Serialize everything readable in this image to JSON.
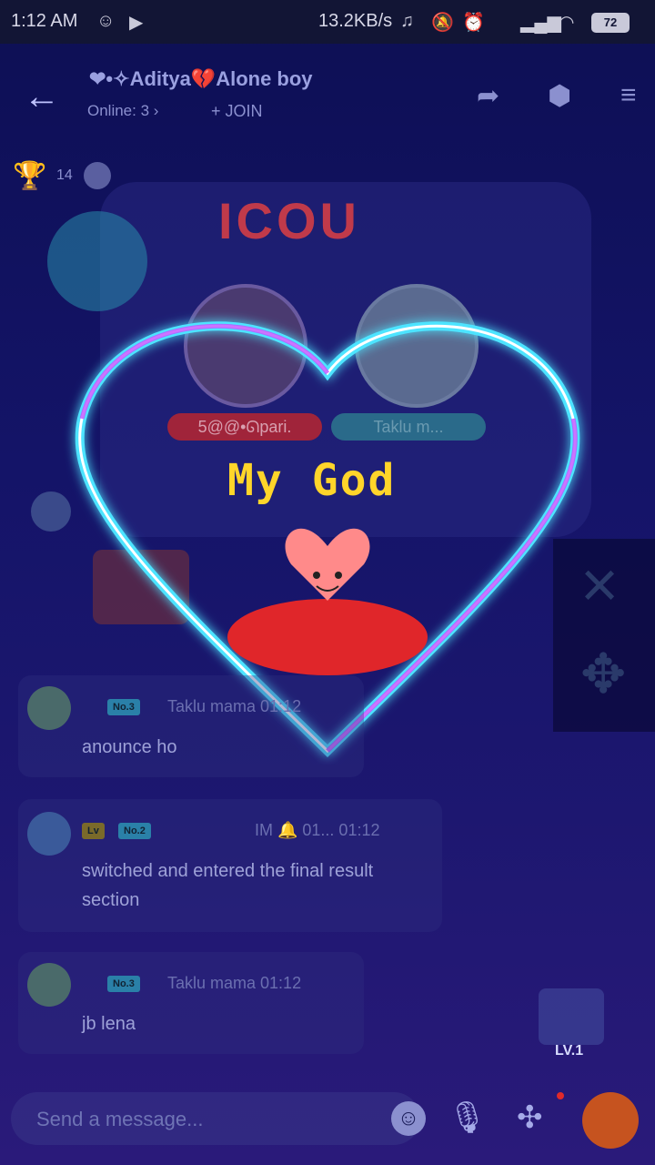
{
  "status_bar": {
    "time": "1:12 AM",
    "network_speed": "13.2KB/s",
    "battery": "72"
  },
  "header": {
    "room_title": "❤•✧Aditya💔Alone boy",
    "online_label": "Online: 3",
    "online_chevron": "›",
    "join_label": "JOIN"
  },
  "trophy": {
    "count": "14"
  },
  "card": {
    "user1_name": "5@@•ᘏpari.",
    "user2_name": "Taklu m..."
  },
  "overlay": {
    "title": "My God"
  },
  "messages": [
    {
      "name": "Taklu mama 01:12",
      "badge": "No.3",
      "text": "anounce ho"
    },
    {
      "name": "IM 🔔 01... 01:12",
      "badge": "No.2",
      "text_line1": "switched and entered the final result",
      "text_line2": "section"
    },
    {
      "name": "Taklu mama 01:12",
      "badge": "No.3",
      "text": "jb lena"
    }
  ],
  "composer": {
    "placeholder": "Send a message..."
  },
  "gift": {
    "level": "LV.1"
  },
  "icons": [
    "back-arrow-icon",
    "share-icon",
    "settings-icon",
    "menu-icon",
    "trophy-icon",
    "emoji-icon",
    "microphone-icon",
    "apps-icon",
    "gift-icon",
    "close-icon",
    "move-icon"
  ],
  "colors": {
    "background": "#141468",
    "overlay_title": "#ffd52a",
    "heart_glow": "#53e4ff"
  }
}
